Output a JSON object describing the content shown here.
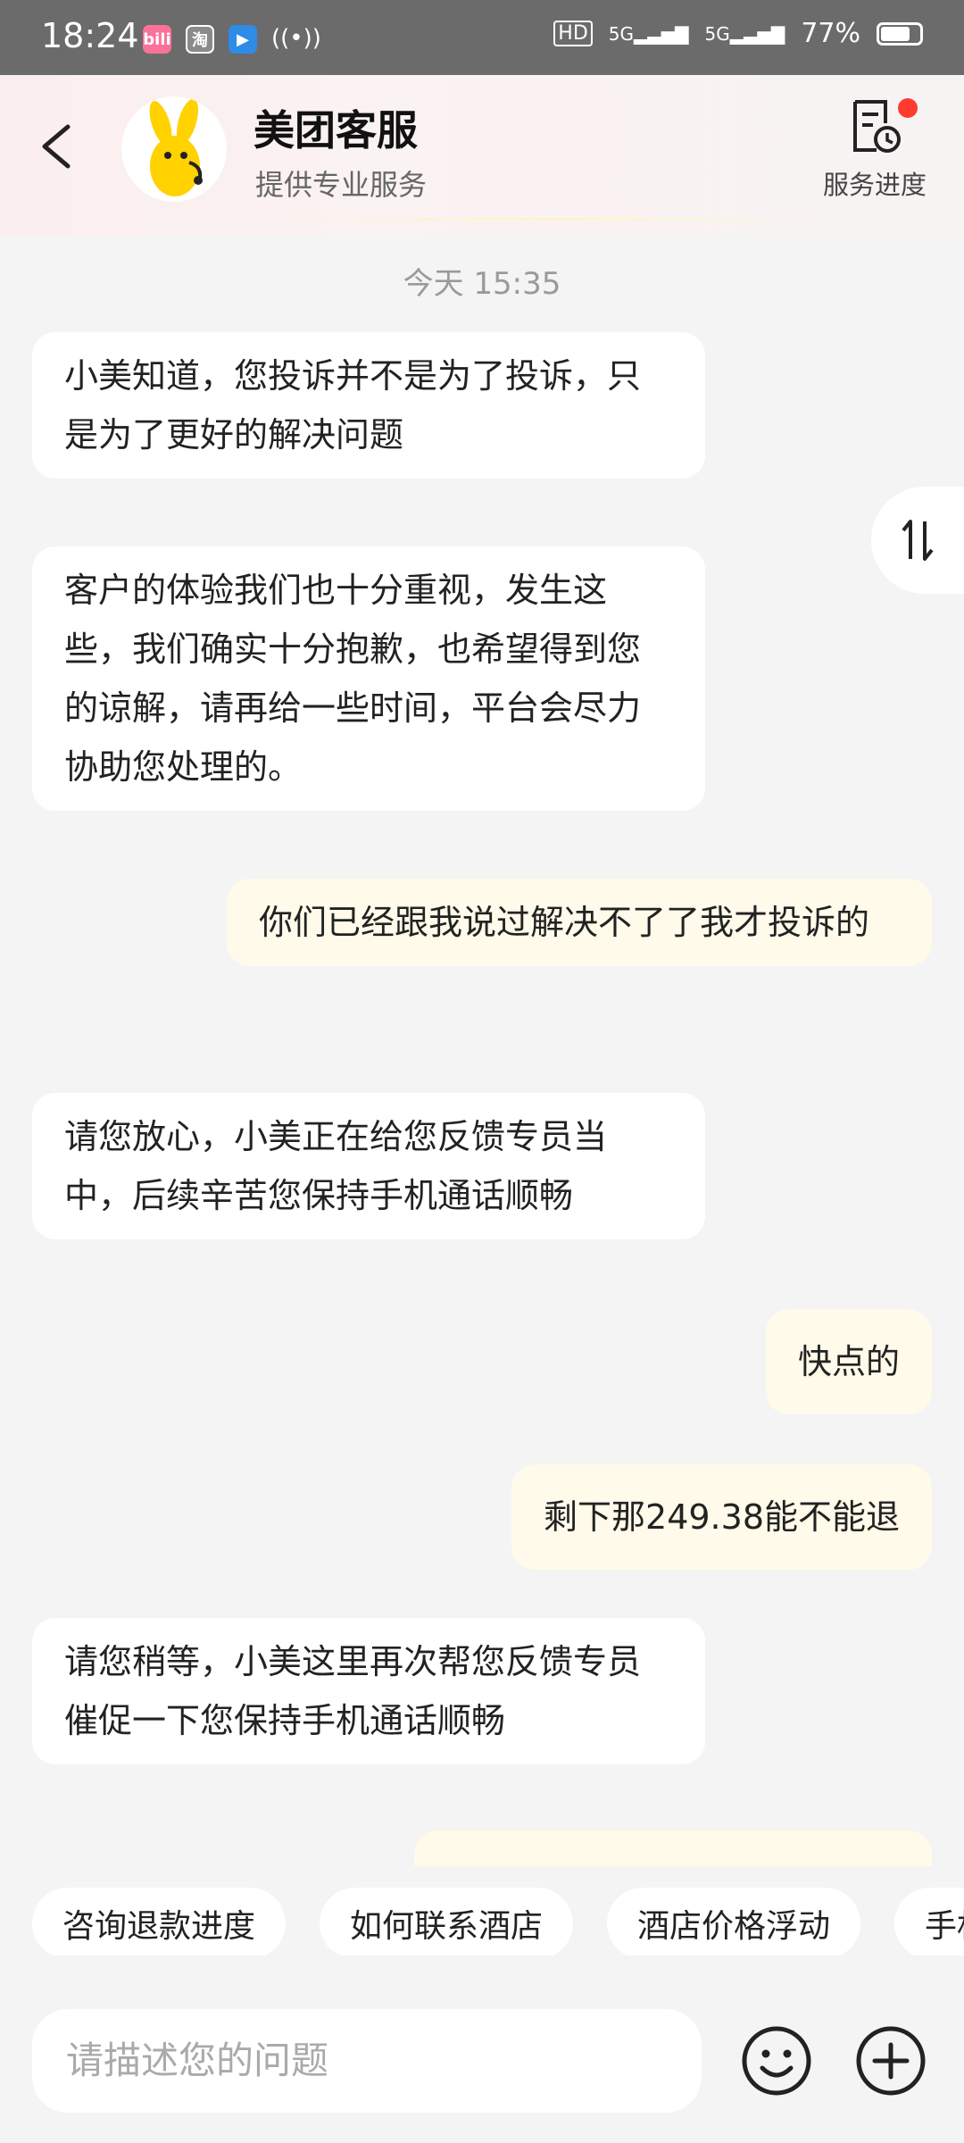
{
  "status_bar": {
    "time": "18:24",
    "apps": [
      {
        "name": "bilibili-app-icon",
        "text": "bili",
        "color": "#fb7299"
      },
      {
        "name": "taobao-app-icon",
        "text": "淘",
        "color": "#8a8a8a"
      },
      {
        "name": "app-icon",
        "text": "▶",
        "color": "#2e8be6"
      }
    ],
    "network_1": "5G",
    "network_2": "5G",
    "battery_percent": "77%",
    "battery_level": 0.77
  },
  "header": {
    "title": "美团客服",
    "subtitle": "提供专业服务",
    "progress_label": "服务进度"
  },
  "chat": {
    "timestamp": "今天 15:35",
    "messages": [
      {
        "side": "left",
        "text": "小美知道，您投诉并不是为了投诉，只是为了更好的解决问题"
      },
      {
        "side": "left",
        "text": "客户的体验我们也十分重视，发生这些，我们确实十分抱歉，也希望得到您的谅解，请再给一些时间，平台会尽力协助您处理的。"
      },
      {
        "side": "right",
        "text": "你们已经跟我说过解决不了了我才投诉的"
      },
      {
        "side": "left",
        "text": "请您放心，小美正在给您反馈专员当中，后续辛苦您保持手机通话顺畅"
      },
      {
        "side": "right",
        "text": "快点的"
      },
      {
        "side": "right",
        "text": "剩下那249.38能不能退"
      },
      {
        "side": "left",
        "text": "请您稍等，小美这里再次帮您反馈专员催促一下您保持手机通话顺畅"
      }
    ]
  },
  "quick_replies": [
    "咨询退款进度",
    "如何联系酒店",
    "酒店价格浮动",
    "手机"
  ],
  "input": {
    "placeholder": "请描述您的问题"
  }
}
